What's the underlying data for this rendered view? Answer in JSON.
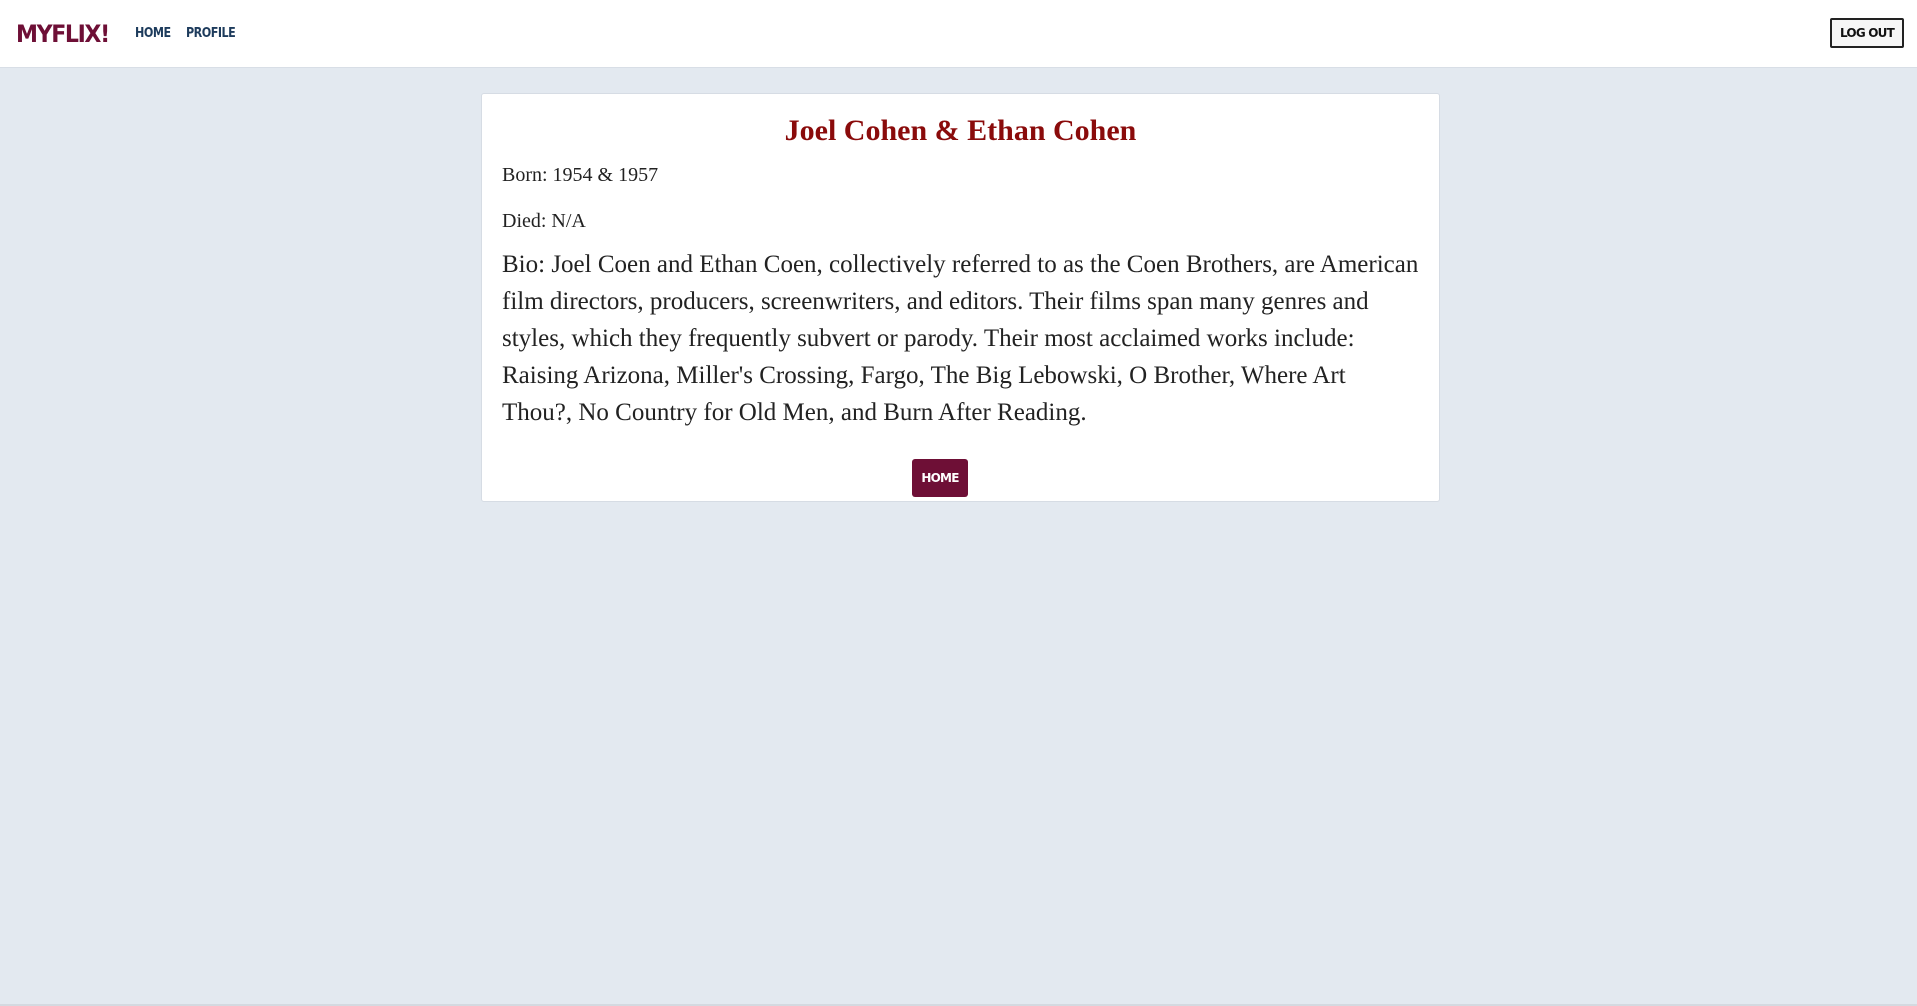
{
  "nav": {
    "brand": "MYFLIX!",
    "links": [
      {
        "label": "HOME"
      },
      {
        "label": "PROFILE"
      }
    ],
    "logout_label": "LOG OUT"
  },
  "director": {
    "name": "Joel Cohen & Ethan Cohen",
    "born": "Born: 1954 & 1957",
    "died": "Died: N/A",
    "bio": "Bio: Joel Coen and Ethan Coen, collectively referred to as the Coen Brothers, are American film directors, producers, screenwriters, and editors. Their films span many genres and styles, which they frequently subvert or parody. Their most acclaimed works include: Raising Arizona, Miller's Crossing, Fargo, The Big Lebowski, O Brother, Where Art Thou?, No Country for Old Men, and Burn After Reading.",
    "home_button_label": "HOME"
  },
  "colors": {
    "brand": "#6e0f36",
    "title": "#8a0b0b",
    "nav_link": "#1d3b5c",
    "page_bg": "#e3e9f0"
  }
}
